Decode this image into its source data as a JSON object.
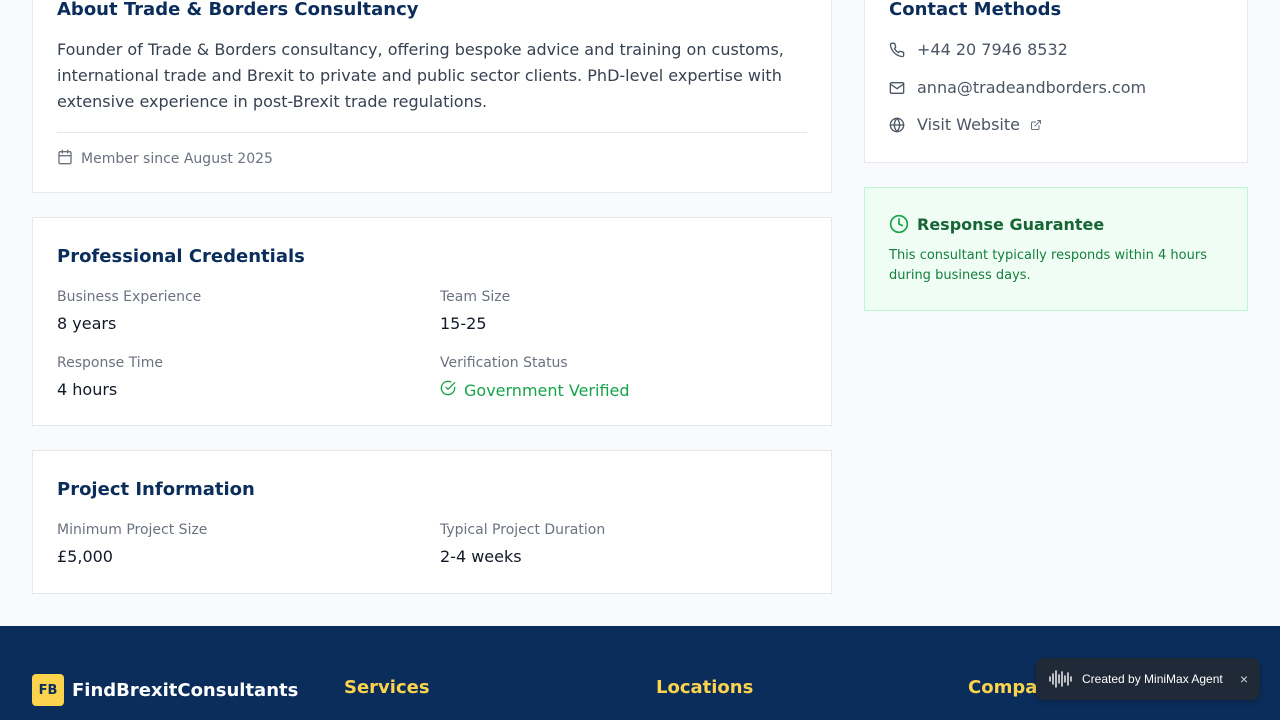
{
  "about": {
    "title": "About Trade & Borders Consultancy",
    "bio": "Founder of Trade & Borders consultancy, offering bespoke advice and training on customs, international trade and Brexit to private and public sector clients. PhD-level expertise with extensive experience in post-Brexit trade regulations.",
    "member_since": "Member since August 2025"
  },
  "credentials": {
    "title": "Professional Credentials",
    "business_experience_label": "Business Experience",
    "business_experience_value": "8 years",
    "team_size_label": "Team Size",
    "team_size_value": "15-25",
    "response_time_label": "Response Time",
    "response_time_value": "4 hours",
    "verification_label": "Verification Status",
    "verification_value": "Government Verified"
  },
  "project": {
    "title": "Project Information",
    "min_size_label": "Minimum Project Size",
    "min_size_value": "£5,000",
    "duration_label": "Typical Project Duration",
    "duration_value": "2-4 weeks"
  },
  "contact": {
    "title": "Contact Methods",
    "phone": "+44 20 7946 8532",
    "email": "anna@tradeandborders.com",
    "website_label": "Visit Website"
  },
  "guarantee": {
    "title": "Response Guarantee",
    "text": "This consultant typically responds within 4 hours during business days."
  },
  "footer": {
    "logo_initials": "FB",
    "brand": "FindBrexitConsultants",
    "col_services": "Services",
    "col_locations": "Locations",
    "col_company": "Company"
  },
  "badge": {
    "text": "Created by MiniMax Agent",
    "close": "×"
  },
  "colors": {
    "navy": "#0b2d5b",
    "accent_yellow": "#fcd34d",
    "verified_green": "#16a34a"
  },
  "icons": {
    "member": "calendar-icon",
    "verified": "check-circle-icon",
    "phone": "phone-icon",
    "email": "mail-icon",
    "website": "globe-icon",
    "external": "external-link-icon",
    "guarantee": "clock-icon",
    "badge": "waveform-icon"
  }
}
